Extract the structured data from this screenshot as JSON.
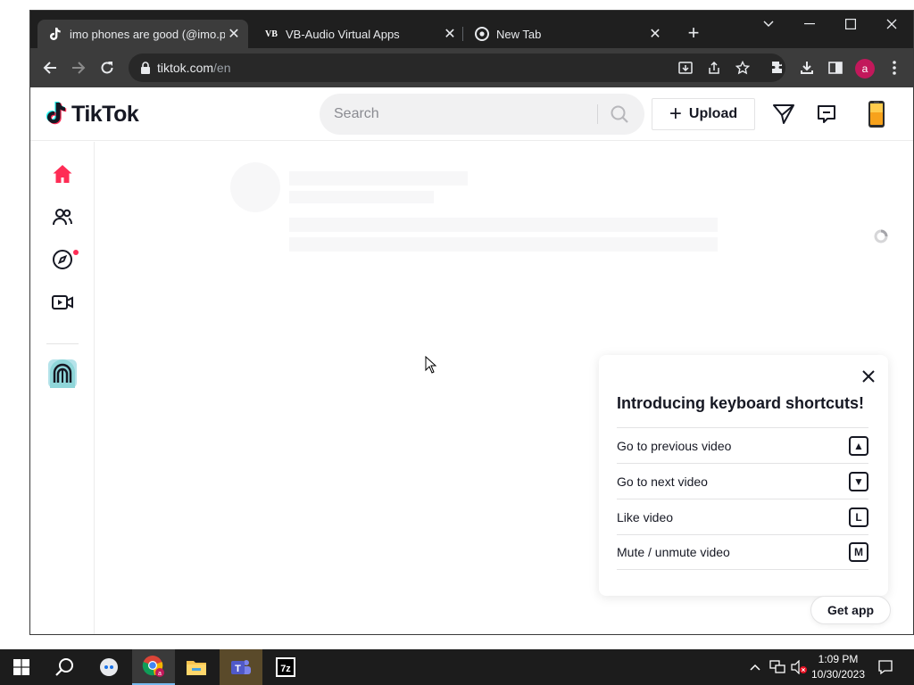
{
  "browser": {
    "tabs": [
      {
        "title": "imo phones are good (@imo.ph",
        "favicon": "tiktok-icon",
        "active": true
      },
      {
        "title": "VB-Audio Virtual Apps",
        "favicon": "VB",
        "active": false
      },
      {
        "title": "New Tab",
        "favicon": "chrome-icon",
        "active": false
      }
    ],
    "url_host": "tiktok.com",
    "url_path": "/en",
    "profile_initial": "a"
  },
  "tiktok": {
    "logo_text": "TikTok",
    "search_placeholder": "Search",
    "upload_label": "Upload",
    "colors": {
      "accent": "#fe2c55",
      "text": "#161823"
    },
    "sidebar": [
      "home-icon",
      "following-icon",
      "explore-icon",
      "live-icon"
    ]
  },
  "shortcuts": {
    "title": "Introducing keyboard shortcuts!",
    "items": [
      {
        "label": "Go to previous video",
        "key": "▲"
      },
      {
        "label": "Go to next video",
        "key": "▼"
      },
      {
        "label": "Like video",
        "key": "L"
      },
      {
        "label": "Mute / unmute video",
        "key": "M"
      }
    ]
  },
  "get_app_label": "Get app",
  "taskbar": {
    "time": "1:09 PM",
    "date": "10/30/2023"
  }
}
